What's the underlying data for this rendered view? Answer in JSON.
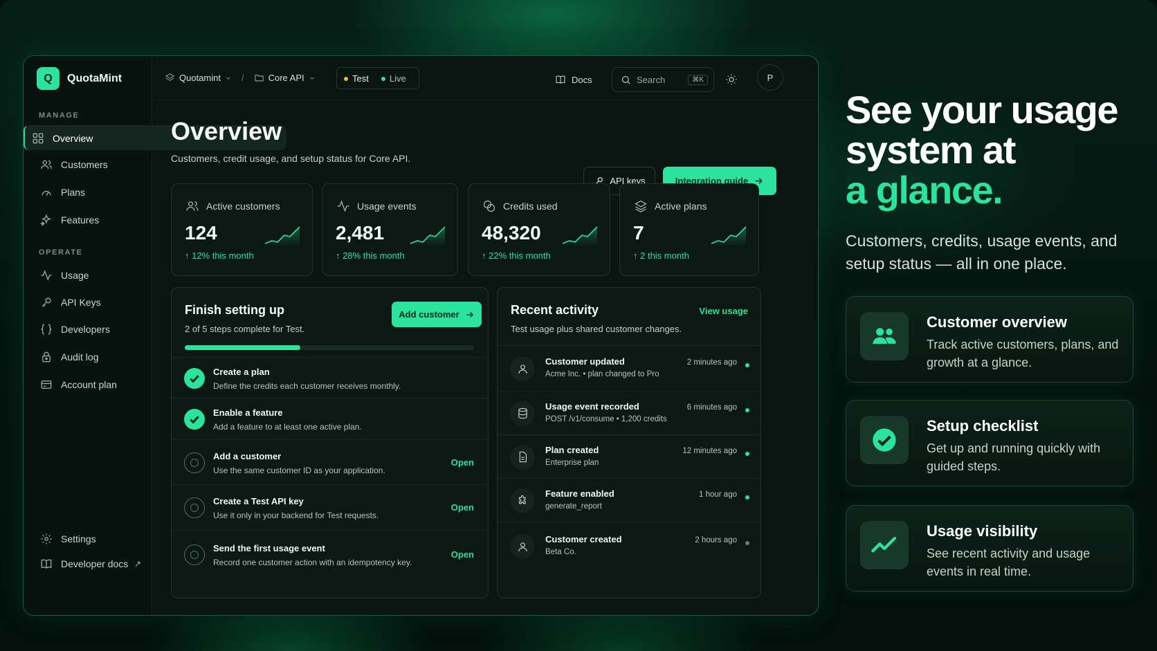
{
  "brand": {
    "logo_letter": "Q",
    "name": "QuotaMint"
  },
  "sidebar": {
    "manage_label": "MANAGE",
    "manage": [
      {
        "label": "Overview",
        "icon": "grid-icon"
      },
      {
        "label": "Customers",
        "icon": "users-icon"
      },
      {
        "label": "Plans",
        "icon": "gauge-icon"
      },
      {
        "label": "Features",
        "icon": "sparkle-icon"
      }
    ],
    "operate_label": "OPERATE",
    "operate": [
      {
        "label": "Usage",
        "icon": "activity-icon"
      },
      {
        "label": "API Keys",
        "icon": "key-icon"
      },
      {
        "label": "Developers",
        "icon": "braces-icon"
      },
      {
        "label": "Audit log",
        "icon": "lock-icon"
      },
      {
        "label": "Account plan",
        "icon": "card-icon"
      }
    ],
    "bottom": [
      {
        "label": "Settings",
        "icon": "gear-icon"
      },
      {
        "label": "Developer docs",
        "icon": "book-icon"
      }
    ]
  },
  "topbar": {
    "workspace": "Quotamint",
    "separator": "/",
    "project": "Core API",
    "env_test": "Test",
    "env_live": "Live",
    "docs": "Docs",
    "search_placeholder": "Search",
    "search_shortcut": "⌘K",
    "avatar": "P"
  },
  "overview": {
    "title": "Overview",
    "subtitle": "Customers, credit usage, and setup status for Core API.",
    "api_keys_button": "API keys",
    "integration_button": "Integration guide"
  },
  "stats": [
    {
      "label": "Active customers",
      "value": "124",
      "delta": "12% this month",
      "icon": "users-icon"
    },
    {
      "label": "Usage events",
      "value": "2,481",
      "delta": "28% this month",
      "icon": "activity-icon"
    },
    {
      "label": "Credits used",
      "value": "48,320",
      "delta": "22% this month",
      "icon": "coins-icon"
    },
    {
      "label": "Active plans",
      "value": "7",
      "delta": "2 this month",
      "icon": "layers-icon"
    }
  ],
  "setup": {
    "title": "Finish setting up",
    "subtitle": "2 of 5 steps complete for Test.",
    "add_customer_button": "Add customer",
    "progress": 0.4,
    "steps": [
      {
        "title": "Create a plan",
        "desc": "Define the credits each customer receives monthly.",
        "done": true,
        "action": ""
      },
      {
        "title": "Enable a feature",
        "desc": "Add a feature to at least one active plan.",
        "done": true,
        "action": ""
      },
      {
        "title": "Add a customer",
        "desc": "Use the same customer ID as your application.",
        "done": false,
        "action": "Open"
      },
      {
        "title": "Create a Test API key",
        "desc": "Use it only in your backend for Test requests.",
        "done": false,
        "action": "Open"
      },
      {
        "title": "Send the first usage event",
        "desc": "Record one customer action with an idempotency key.",
        "done": false,
        "action": "Open"
      }
    ]
  },
  "activity": {
    "title": "Recent activity",
    "subtitle": "Test usage plus shared customer changes.",
    "link": "View usage",
    "items": [
      {
        "title": "Customer updated",
        "desc": "Acme Inc. • plan changed to Pro",
        "time": "2 minutes ago",
        "icon": "user-icon",
        "live": true
      },
      {
        "title": "Usage event recorded",
        "desc": "POST /v1/consume • 1,200 credits",
        "time": "6 minutes ago",
        "icon": "database-icon",
        "live": true
      },
      {
        "title": "Plan created",
        "desc": "Enterprise plan",
        "time": "12 minutes ago",
        "icon": "file-icon",
        "live": true
      },
      {
        "title": "Feature enabled",
        "desc": "generate_report",
        "time": "1 hour ago",
        "icon": "puzzle-icon",
        "live": true
      },
      {
        "title": "Customer created",
        "desc": "Beta Co.",
        "time": "2 hours ago",
        "icon": "user-icon",
        "live": false
      }
    ]
  },
  "hero": {
    "line1": "See your usage",
    "line2": "system at",
    "line3": "a glance.",
    "subtitle": "Customers, credits, usage events, and setup status — all in one place."
  },
  "features": [
    {
      "title": "Customer overview",
      "desc": "Track active customers, plans, and growth at a glance.",
      "icon": "users-icon"
    },
    {
      "title": "Setup checklist",
      "desc": "Get up and running quickly with guided steps.",
      "icon": "check-circle-icon"
    },
    {
      "title": "Usage visibility",
      "desc": "See recent activity and usage events in real time.",
      "icon": "trend-icon"
    }
  ],
  "colors": {
    "accent": "#2be39c",
    "background": "#04110c",
    "panel": "#0c1814",
    "dot_live": "#2be39c",
    "dot_idle": "#6b7a73",
    "env_test": "#f5b829"
  }
}
